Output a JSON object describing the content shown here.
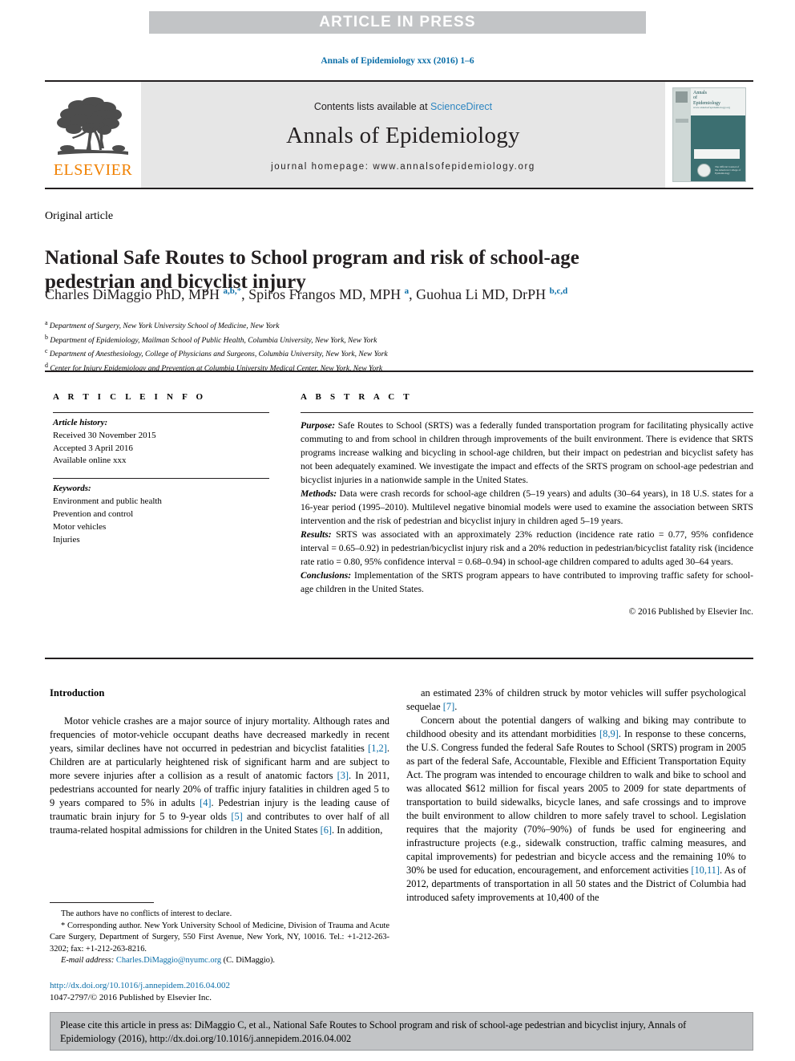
{
  "banner": {
    "text": "ARTICLE IN PRESS"
  },
  "journal_ref": "Annals of Epidemiology xxx (2016) 1–6",
  "masthead": {
    "contents_prefix": "Contents lists available at ",
    "sciencedirect": "ScienceDirect",
    "journal_title": "Annals of Epidemiology",
    "homepage": "journal homepage: www.annalsofepidemiology.org",
    "publisher": "ELSEVIER",
    "cover": {
      "line1": "Annals",
      "line2": "of",
      "line3": "Epidemiology",
      "subtitle": "www.annalsofepidemiology.org",
      "seal_text": "The Official Journal of the American College of Epidemiology"
    }
  },
  "article": {
    "type": "Original article",
    "title": "National Safe Routes to School program and risk of school-age pedestrian and bicyclist injury",
    "authors_html": "Charles DiMaggio PhD, MPH <sup>a,b,</sup><sup class=\"star\">*</sup>, Spiros Frangos MD, MPH <sup>a</sup>, Guohua Li MD, DrPH <sup>b,c,d</sup>",
    "affiliations": [
      {
        "marker": "a",
        "text": "Department of Surgery, New York University School of Medicine, New York"
      },
      {
        "marker": "b",
        "text": "Department of Epidemiology, Mailman School of Public Health, Columbia University, New York, New York"
      },
      {
        "marker": "c",
        "text": "Department of Anesthesiology, College of Physicians and Surgeons, Columbia University, New York, New York"
      },
      {
        "marker": "d",
        "text": "Center for Injury Epidemiology and Prevention at Columbia University Medical Center, New York, New York"
      }
    ]
  },
  "article_info": {
    "heading": "A R T I C L E    I N F O",
    "history_label": "Article history:",
    "history": [
      "Received 30 November 2015",
      "Accepted 3 April 2016",
      "Available online xxx"
    ],
    "keywords_label": "Keywords:",
    "keywords": [
      "Environment and public health",
      "Prevention and control",
      "Motor vehicles",
      "Injuries"
    ]
  },
  "abstract": {
    "heading": "A B S T R A C T",
    "sections": [
      {
        "label": "Purpose:",
        "text": " Safe Routes to School (SRTS) was a federally funded transportation program for facilitating physically active commuting to and from school in children through improvements of the built environment. There is evidence that SRTS programs increase walking and bicycling in school-age children, but their impact on pedestrian and bicyclist safety has not been adequately examined. We investigate the impact and effects of the SRTS program on school-age pedestrian and bicyclist injuries in a nationwide sample in the United States."
      },
      {
        "label": "Methods:",
        "text": " Data were crash records for school-age children (5–19 years) and adults (30–64 years), in 18 U.S. states for a 16-year period (1995–2010). Multilevel negative binomial models were used to examine the association between SRTS intervention and the risk of pedestrian and bicyclist injury in children aged 5–19 years."
      },
      {
        "label": "Results:",
        "text": " SRTS was associated with an approximately 23% reduction (incidence rate ratio = 0.77, 95% confidence interval = 0.65–0.92) in pedestrian/bicyclist injury risk and a 20% reduction in pedestrian/bicyclist fatality risk (incidence rate ratio = 0.80, 95% confidence interval = 0.68–0.94) in school-age children compared to adults aged 30–64 years."
      },
      {
        "label": "Conclusions:",
        "text": " Implementation of the SRTS program appears to have contributed to improving traffic safety for school-age children in the United States."
      }
    ],
    "copyright": "© 2016 Published by Elsevier Inc."
  },
  "introduction": {
    "heading": "Introduction",
    "left_paragraphs": [
      "Motor vehicle crashes are a major source of injury mortality. Although rates and frequencies of motor-vehicle occupant deaths have decreased markedly in recent years, similar declines have not occurred in pedestrian and bicyclist fatalities [1,2]. Children are at particularly heightened risk of significant harm and are subject to more severe injuries after a collision as a result of anatomic factors [3]. In 2011, pedestrians accounted for nearly 20% of traffic injury fatalities in children aged 5 to 9 years compared to 5% in adults [4]. Pedestrian injury is the leading cause of traumatic brain injury for 5 to 9-year olds [5] and contributes to over half of all trauma-related hospital admissions for children in the United States [6]. In addition,"
    ],
    "right_paragraphs": [
      "an estimated 23% of children struck by motor vehicles will suffer psychological sequelae [7].",
      "Concern about the potential dangers of walking and biking may contribute to childhood obesity and its attendant morbidities [8,9]. In response to these concerns, the U.S. Congress funded the federal Safe Routes to School (SRTS) program in 2005 as part of the federal Safe, Accountable, Flexible and Efficient Transportation Equity Act. The program was intended to encourage children to walk and bike to school and was allocated $612 million for fiscal years 2005 to 2009 for state departments of transportation to build sidewalks, bicycle lanes, and safe crossings and to improve the built environment to allow children to more safely travel to school. Legislation requires that the majority (70%–90%) of funds be used for engineering and infrastructure projects (e.g., sidewalk construction, traffic calming measures, and capital improvements) for pedestrian and bicycle access and the remaining 10% to 30% be used for education, encouragement, and enforcement activities [10,11]. As of 2012, departments of transportation in all 50 states and the District of Columbia had introduced safety improvements at 10,400 of the"
    ]
  },
  "footnotes": {
    "conflict": "The authors have no conflicts of interest to declare.",
    "corresponding": "* Corresponding author. New York University School of Medicine, Division of Trauma and Acute Care Surgery, Department of Surgery, 550 First Avenue, New York, NY, 10016. Tel.: +1-212-263-3202; fax: +1-212-263-8216.",
    "email_label": "E-mail address:",
    "email": "Charles.DiMaggio@nyumc.org",
    "email_suffix": " (C. DiMaggio).",
    "doi": "http://dx.doi.org/10.1016/j.annepidem.2016.04.002",
    "issn_line": "1047-2797/© 2016 Published by Elsevier Inc."
  },
  "cite_box": {
    "text": "Please cite this article in press as: DiMaggio C, et al., National Safe Routes to School program and risk of school-age pedestrian and bicyclist injury, Annals of Epidemiology (2016), http://dx.doi.org/10.1016/j.annepidem.2016.04.002"
  }
}
